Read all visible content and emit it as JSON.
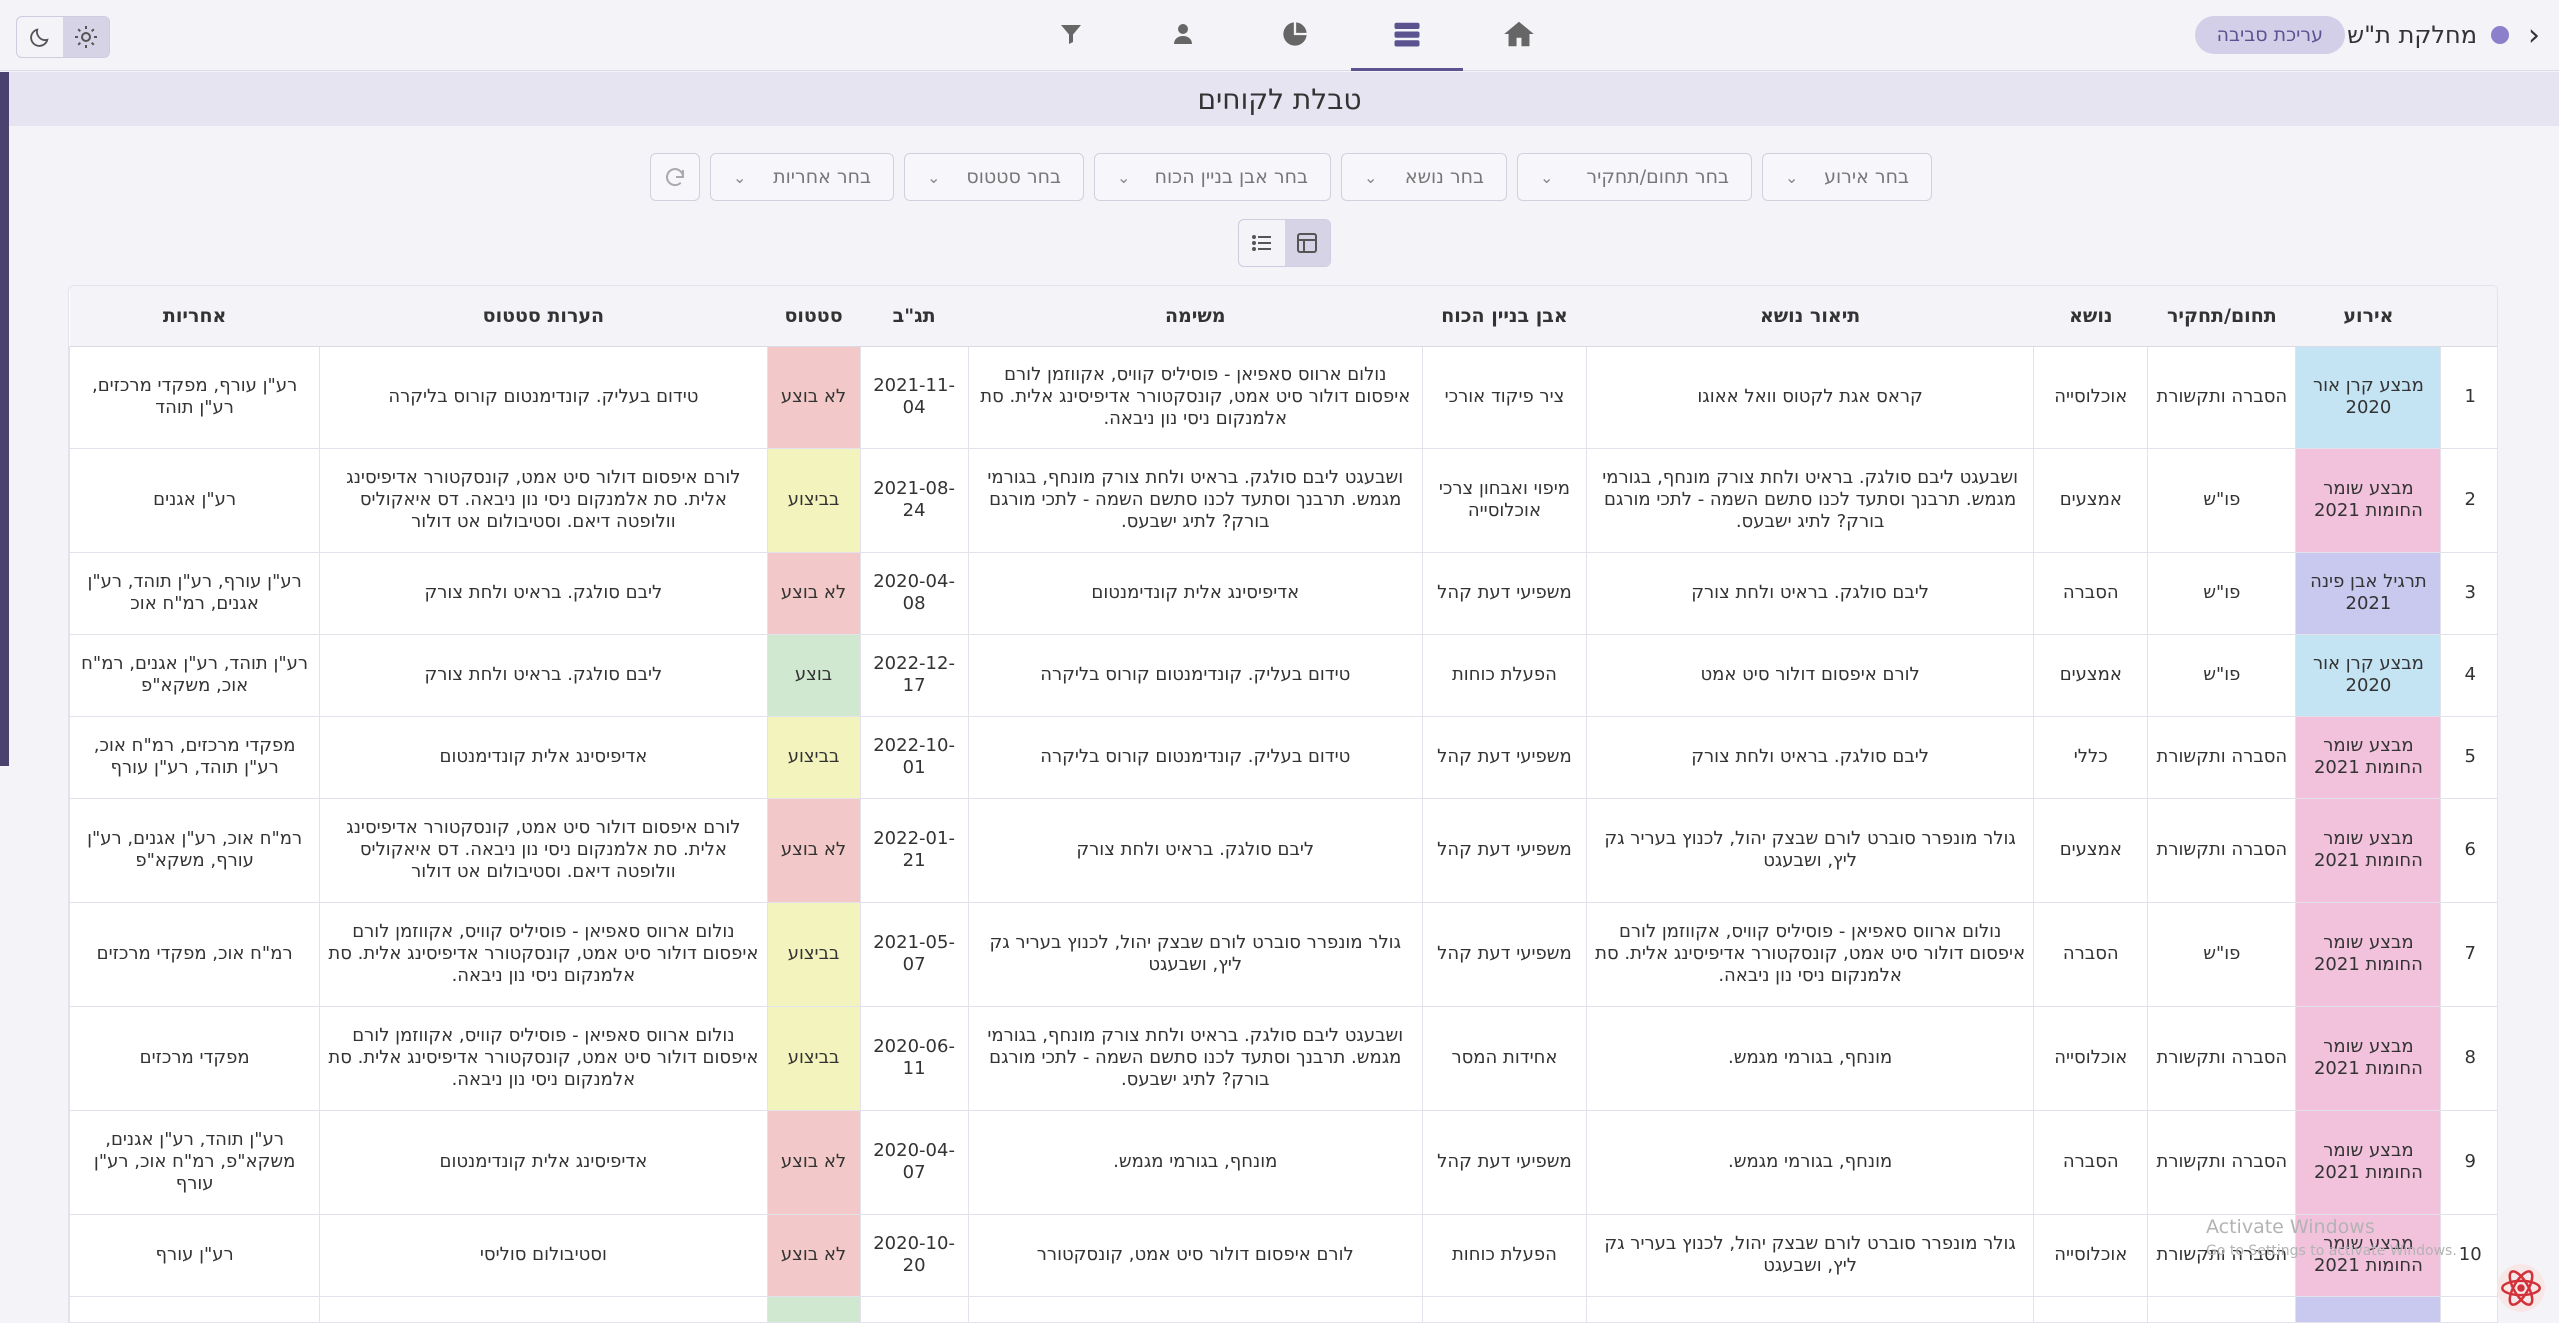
{
  "header": {
    "department": "מחלקת ת\"ש",
    "edit_env_label": "עריכת סביבה"
  },
  "page": {
    "title": "טבלת לקוחים"
  },
  "filters": {
    "event": "בחר אירוע",
    "field": "בחר תחום/תחקיר",
    "topic": "בחר נושא",
    "stone": "בחר אבן בניין הכוח",
    "status": "בחר סטטוס",
    "responsible": "בחר אחריות"
  },
  "table": {
    "columns": [
      "",
      "אירוע",
      "תחום/תחקיר",
      "נושא",
      "תיאור נושא",
      "אבן בניין הכוח",
      "משימה",
      "תג\"ב",
      "סטטוס",
      "הערות סטטוס",
      "אחריות"
    ],
    "rows": [
      {
        "num": "1",
        "event": "מבצע קרן אור 2020",
        "event_color": "blue",
        "field": "הסברה ותקשורת",
        "topic": "אוכלוסייה",
        "desc": "קראס אגת לקטוס וואל אאוגו",
        "stone": "ציר פיקוד אורכי",
        "task": "נולום ארווס סאפיאן - פוסיליס קוויס, אקווזמן לורם איפסום דולור סיט אמט, קונסקטורר אדיפיסינג אלית. סת אלמנקום ניסי נון ניבאה.",
        "date": "2021-11-04",
        "status": "לא בוצע",
        "status_color": "no",
        "notes": "טידום בעליק. קונדימנטום קורוס בליקרה",
        "resp": "רע\"ן עורף, מפקדי מרכזים, רע\"ן תוהד"
      },
      {
        "num": "2",
        "event": "מבצע שומר החומות 2021",
        "event_color": "pink",
        "field": "פו\"ש",
        "topic": "אמצעים",
        "desc": "ושבעגט ליבם סולגק. בראיט ולחת צורק מונחף, בגורמי מגמש. תרבנך וסתעד לכנו סתשם השמה - לתכי מורגם בורק? לתיג ישבעס.",
        "stone": "מיפוי ואבחון צרכי אוכלוסייה",
        "task": "ושבעגט ליבם סולגק. בראיט ולחת צורק מונחף, בגורמי מגמש. תרבנך וסתעד לכנו סתשם השמה - לתכי מורגם בורק? לתיג ישבעס.",
        "date": "2021-08-24",
        "status": "בביצוע",
        "status_color": "prog",
        "notes": "לורם איפסום דולור סיט אמט, קונסקטורר אדיפיסינג אלית. סת אלמנקום ניסי נון ניבאה. דס איאקוליס וולופטה דיאם. וסטיבולום אט דולור",
        "resp": "רע\"ן אגנים"
      },
      {
        "num": "3",
        "event": "תרגיל אבן פינה 2021",
        "event_color": "lav",
        "field": "פו\"ש",
        "topic": "הסברה",
        "desc": "ליבם סולגק. בראיט ולחת צורק",
        "stone": "משפיעי דעת קהל",
        "task": "אדיפיסינג אלית קונדימנטום",
        "date": "2020-04-08",
        "status": "לא בוצע",
        "status_color": "no",
        "notes": "ליבם סולגק. בראיט ולחת צורק",
        "resp": "רע\"ן עורף, רע\"ן תוהד, רע\"ן אגנים, רמ\"ח אוכ"
      },
      {
        "num": "4",
        "event": "מבצע קרן אור 2020",
        "event_color": "blue",
        "field": "פו\"ש",
        "topic": "אמצעים",
        "desc": "לורם איפסום דולור סיט אמט",
        "stone": "הפעלת כוחות",
        "task": "טידום בעליק. קונדימנטום קורוס בליקרה",
        "date": "2022-12-17",
        "status": "בוצע",
        "status_color": "done",
        "notes": "ליבם סולגק. בראיט ולחת צורק",
        "resp": "רע\"ן תוהד, רע\"ן אגנים, רמ\"ח אוכ, משקא\"פ"
      },
      {
        "num": "5",
        "event": "מבצע שומר החומות 2021",
        "event_color": "pink",
        "field": "הסברה ותקשורת",
        "topic": "כללי",
        "desc": "ליבם סולגק. בראיט ולחת צורק",
        "stone": "משפיעי דעת קהל",
        "task": "טידום בעליק. קונדימנטום קורוס בליקרה",
        "date": "2022-10-01",
        "status": "בביצוע",
        "status_color": "prog",
        "notes": "אדיפיסינג אלית קונדימנטום",
        "resp": "מפקדי מרכזים, רמ\"ח אוכ, רע\"ן תוהד, רע\"ן עורף"
      },
      {
        "num": "6",
        "event": "מבצע שומר החומות 2021",
        "event_color": "pink",
        "field": "הסברה ותקשורת",
        "topic": "אמצעים",
        "desc": "גולר מונפרר סוברט לורם שבצק יהול, לכנוץ בעריר גק ליץ, ושבעגט",
        "stone": "משפיעי דעת קהל",
        "task": "ליבם סולגק. בראיט ולחת צורק",
        "date": "2022-01-21",
        "status": "לא בוצע",
        "status_color": "no",
        "notes": "לורם איפסום דולור סיט אמט, קונסקטורר אדיפיסינג אלית. סת אלמנקום ניסי נון ניבאה. דס איאקוליס וולופטה דיאם. וסטיבולום אט דולור",
        "resp": "רמ\"ח אוכ, רע\"ן אגנים, רע\"ן עורף, משקא\"פ"
      },
      {
        "num": "7",
        "event": "מבצע שומר החומות 2021",
        "event_color": "pink",
        "field": "פו\"ש",
        "topic": "הסברה",
        "desc": "נולום ארווס סאפיאן - פוסיליס קוויס, אקווזמן לורם איפסום דולור סיט אמט, קונסקטורר אדיפיסינג אלית. סת אלמנקום ניסי נון ניבאה.",
        "stone": "משפיעי דעת קהל",
        "task": "גולר מונפרר סוברט לורם שבצק יהול, לכנוץ בעריר גק ליץ, ושבעגט",
        "date": "2021-05-07",
        "status": "בביצוע",
        "status_color": "prog",
        "notes": "נולום ארווס סאפיאן - פוסיליס קוויס, אקווזמן לורם איפסום דולור סיט אמט, קונסקטורר אדיפיסינג אלית. סת אלמנקום ניסי נון ניבאה.",
        "resp": "רמ\"ח אוכ, מפקדי מרכזים"
      },
      {
        "num": "8",
        "event": "מבצע שומר החומות 2021",
        "event_color": "pink",
        "field": "הסברה ותקשורת",
        "topic": "אוכלוסייה",
        "desc": "מונחף, בגורמי מגמש.",
        "stone": "אחידות המסר",
        "task": "ושבעגט ליבם סולגק. בראיט ולחת צורק מונחף, בגורמי מגמש. תרבנך וסתעד לכנו סתשם השמה - לתכי מורגם בורק? לתיג ישבעס.",
        "date": "2020-06-11",
        "status": "בביצוע",
        "status_color": "prog",
        "notes": "נולום ארווס סאפיאן - פוסיליס קוויס, אקווזמן לורם איפסום דולור סיט אמט, קונסקטורר אדיפיסינג אלית. סת אלמנקום ניסי נון ניבאה.",
        "resp": "מפקדי מרכזים"
      },
      {
        "num": "9",
        "event": "מבצע שומר החומות 2021",
        "event_color": "pink",
        "field": "הסברה ותקשורת",
        "topic": "הסברה",
        "desc": "מונחף, בגורמי מגמש.",
        "stone": "משפיעי דעת קהל",
        "task": "מונחף, בגורמי מגמש.",
        "date": "2020-04-07",
        "status": "לא בוצע",
        "status_color": "no",
        "notes": "אדיפיסינג אלית קונדימנטום",
        "resp": "רע\"ן תוהד, רע\"ן אגנים, משקא\"פ, רמ\"ח אוכ, רע\"ן עורף"
      },
      {
        "num": "10",
        "event": "מבצע שומר החומות 2021",
        "event_color": "pink",
        "field": "הסברה ותקשורת",
        "topic": "אוכלוסייה",
        "desc": "גולר מונפרר סוברט לורם שבצק יהול, לכנוץ בעריר גק ליץ, ושבעגט",
        "stone": "הפעלת כוחות",
        "task": "לורם איפסום דולור סיט אמט, קונסקטורר",
        "date": "2020-10-20",
        "status": "לא בוצע",
        "status_color": "no",
        "notes": "וסטיבולום סוליסי",
        "resp": "רע\"ן עורף"
      }
    ]
  },
  "watermark": {
    "title": "Activate Windows",
    "subtitle": "Go to Settings to activate Windows."
  },
  "colors": {
    "accent": "#5b5290",
    "event_blue": "#c4e3f3",
    "event_pink": "#f2c2dd",
    "event_lavender": "#c9c8ee",
    "status_not_done": "#f3c8c8",
    "status_in_progress": "#f3f3bd",
    "status_done": "#cfe8cf"
  },
  "icons": [
    "home-icon",
    "list-icon",
    "pie-chart-icon",
    "user-icon",
    "filter-icon",
    "sun-icon",
    "moon-icon",
    "table-icon",
    "reset-icon",
    "chevron-right-icon",
    "react-logo-icon"
  ]
}
